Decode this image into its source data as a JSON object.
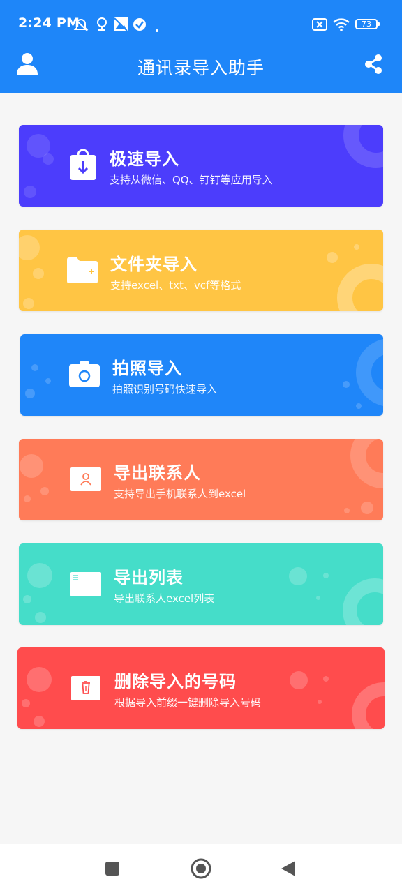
{
  "status_bar": {
    "time": "2:24 PM",
    "battery": "73",
    "icons": [
      "mute-bell-icon",
      "location-icon",
      "image-icon",
      "check-circle-icon",
      "dot-icon",
      "sim-off-icon",
      "wifi-icon",
      "battery-icon"
    ]
  },
  "app_bar": {
    "title": "通讯录导入助手",
    "left_icon": "user-icon",
    "right_icon": "share-icon"
  },
  "cards": [
    {
      "title": "极速导入",
      "subtitle": "支持从微信、QQ、钉钉等应用导入",
      "color": "#4c3dfc",
      "icon": "download-bag-icon"
    },
    {
      "title": "文件夹导入",
      "subtitle": "支持excel、txt、vcf等格式",
      "color": "#ffc544",
      "icon": "folder-add-icon"
    },
    {
      "title": "拍照导入",
      "subtitle": "拍照识别号码快速导入",
      "color": "#1f86f9",
      "icon": "camera-icon"
    },
    {
      "title": "导出联系人",
      "subtitle": "支持导出手机联系人到excel",
      "color": "#ff7b58",
      "icon": "contact-card-icon"
    },
    {
      "title": "导出列表",
      "subtitle": "导出联系人excel列表",
      "color": "#45ddc9",
      "icon": "list-icon"
    },
    {
      "title": "删除导入的号码",
      "subtitle": "根据导入前缀一键删除导入号码",
      "color": "#ff4c4d",
      "icon": "trash-icon"
    }
  ],
  "nav_bar": {
    "icons": [
      "recents-square-icon",
      "home-circle-icon",
      "back-triangle-icon"
    ]
  }
}
